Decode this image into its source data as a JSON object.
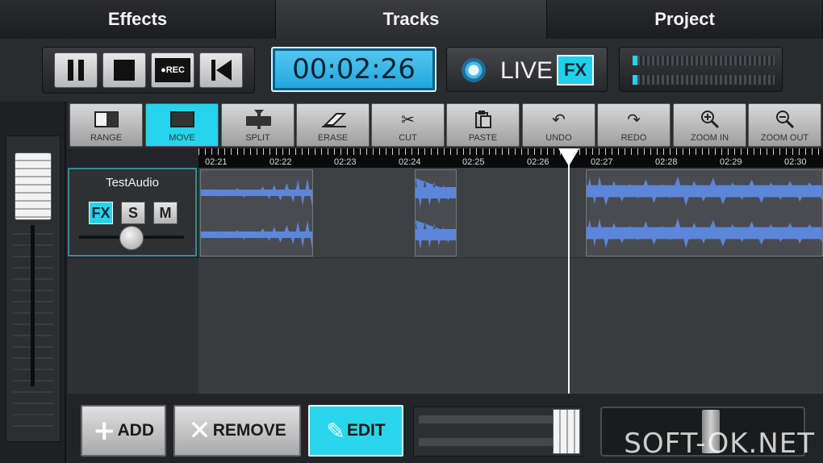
{
  "tabs": [
    {
      "label": "Effects"
    },
    {
      "label": "Tracks"
    },
    {
      "label": "Project"
    }
  ],
  "transport": {
    "buttons": [
      {
        "icon": "pause-icon"
      },
      {
        "icon": "stop-icon"
      },
      {
        "icon": "record-icon",
        "label": "●REC"
      },
      {
        "icon": "skip-back-icon"
      }
    ],
    "time": "00:02:26",
    "live_label": "LIVE",
    "fx_label": "FX"
  },
  "toolbar": [
    {
      "label": "RANGE",
      "icon": "range-icon"
    },
    {
      "label": "MOVE",
      "icon": "move-icon",
      "active": true
    },
    {
      "label": "SPLIT",
      "icon": "split-icon"
    },
    {
      "label": "ERASE",
      "icon": "erase-icon"
    },
    {
      "label": "CUT",
      "icon": "scissors-icon"
    },
    {
      "label": "PASTE",
      "icon": "paste-icon"
    },
    {
      "label": "UNDO",
      "icon": "undo-icon"
    },
    {
      "label": "REDO",
      "icon": "redo-icon"
    },
    {
      "label": "ZOOM IN",
      "icon": "zoom-in-icon"
    },
    {
      "label": "ZOOM OUT",
      "icon": "zoom-out-icon"
    }
  ],
  "ruler": [
    "02:21",
    "02:22",
    "02:23",
    "02:24",
    "02:25",
    "02:26",
    "02:27",
    "02:28",
    "02:29",
    "02:30"
  ],
  "track": {
    "name": "TestAudio",
    "fx": "FX",
    "solo": "S",
    "mute": "M"
  },
  "bottom": {
    "add": "ADD",
    "remove": "REMOVE",
    "edit": "EDIT"
  },
  "colors": {
    "accent": "#26d3ec",
    "waveform": "#5b86d9",
    "time_display": "#3bb8e8"
  },
  "watermark": "SOFT-OK.NET"
}
